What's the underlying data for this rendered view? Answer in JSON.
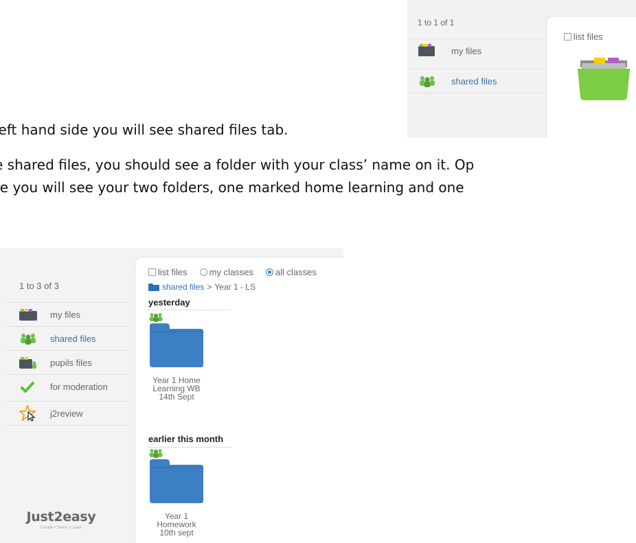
{
  "document": {
    "line1": "left hand side you will see shared files tab.",
    "line2": "e shared files, you should see a folder with your class’ name on it.  Op",
    "line3": "re you will see your two folders, one marked home learning and one"
  },
  "top_screenshot": {
    "count": "1 to 1 of 1",
    "items": [
      {
        "label": "my files"
      },
      {
        "label": "shared files"
      }
    ],
    "list_files_label": "list files"
  },
  "main_screenshot": {
    "count": "1 to 3 of 3",
    "nav": [
      {
        "label": "my files"
      },
      {
        "label": "shared files"
      },
      {
        "label": "pupils files"
      },
      {
        "label": "for moderation"
      },
      {
        "label": "j2review"
      }
    ],
    "options": {
      "list_files": "list files",
      "my_classes": "my classes",
      "all_classes": "all classes",
      "selected": "all classes"
    },
    "breadcrumb": {
      "root": "shared files",
      "separator": ">",
      "current": "Year 1 - LS"
    },
    "sections": [
      {
        "heading": "yesterday",
        "folder": {
          "line1": "Year 1 Home",
          "line2": "Learning WB",
          "line3": "14th Sept"
        }
      },
      {
        "heading": "earlier this month",
        "folder": {
          "line1": "Year 1",
          "line2": "Homework",
          "line3": "10th sept"
        }
      }
    ],
    "logo": {
      "brand": "Just2easy",
      "tagline": "Create • Share • Learn"
    }
  },
  "colors": {
    "folder_blue": "#3d7fc4",
    "folder_green": "#7ccc45",
    "link_blue": "#2f6fb5",
    "moderation_green": "#5bbf3a",
    "star_orange": "#f5a623"
  }
}
